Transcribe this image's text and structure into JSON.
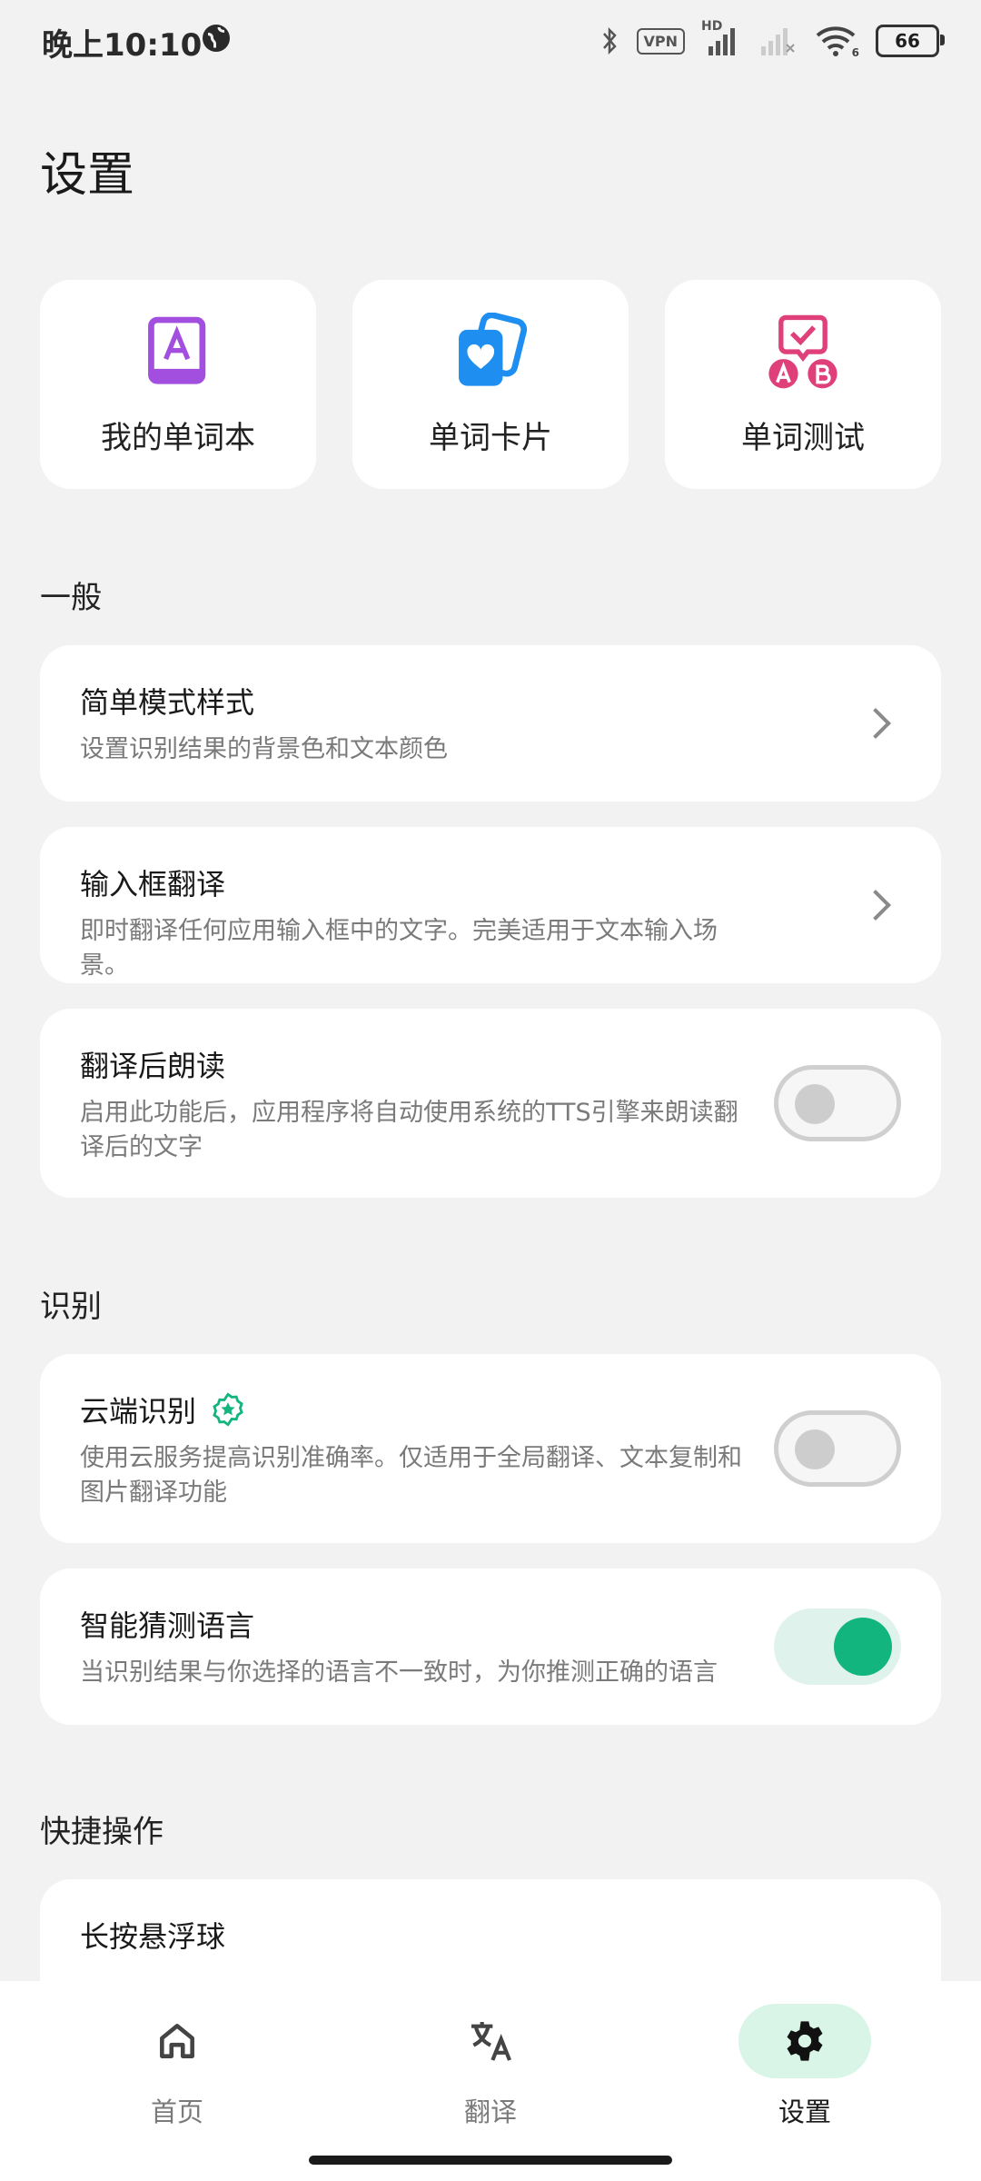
{
  "status_bar": {
    "time": "晚上10:10",
    "vpn": "VPN",
    "hd": "HD",
    "wifi_sub": "6",
    "battery": "66"
  },
  "page": {
    "title": "设置"
  },
  "quick_cards": [
    {
      "label": "我的单词本",
      "icon": "wordbook-icon",
      "color": "#a24fe0"
    },
    {
      "label": "单词卡片",
      "icon": "word-cards-icon",
      "color": "#1e8ef0"
    },
    {
      "label": "单词测试",
      "icon": "word-test-icon",
      "color": "#e0407a"
    }
  ],
  "sections": {
    "general": "一般",
    "recognition": "识别",
    "shortcuts": "快捷操作"
  },
  "settings": {
    "simple_mode": {
      "title": "简单模式样式",
      "desc": "设置识别结果的背景色和文本颜色"
    },
    "input_translate": {
      "title": "输入框翻译",
      "desc": "即时翻译任何应用输入框中的文字。完美适用于文本输入场景。"
    },
    "read_after": {
      "title": "翻译后朗读",
      "desc": "启用此功能后，应用程序将自动使用系统的TTS引擎来朗读翻译后的文字",
      "enabled": false
    },
    "cloud_ocr": {
      "title": "云端识别",
      "desc": "使用云服务提高识别准确率。仅适用于全局翻译、文本复制和图片翻译功能",
      "enabled": false
    },
    "smart_lang": {
      "title": "智能猜测语言",
      "desc": "当识别结果与你选择的语言不一致时，为你推测正确的语言",
      "enabled": true
    },
    "long_press": {
      "title": "长按悬浮球"
    }
  },
  "bottom_nav": [
    {
      "label": "首页",
      "icon": "home-icon",
      "active": false
    },
    {
      "label": "翻译",
      "icon": "translate-icon",
      "active": false
    },
    {
      "label": "设置",
      "icon": "gear-icon",
      "active": true
    }
  ],
  "colors": {
    "accent": "#13b57f",
    "accent_light": "#d8f5e8",
    "background": "#f2f2f2"
  }
}
